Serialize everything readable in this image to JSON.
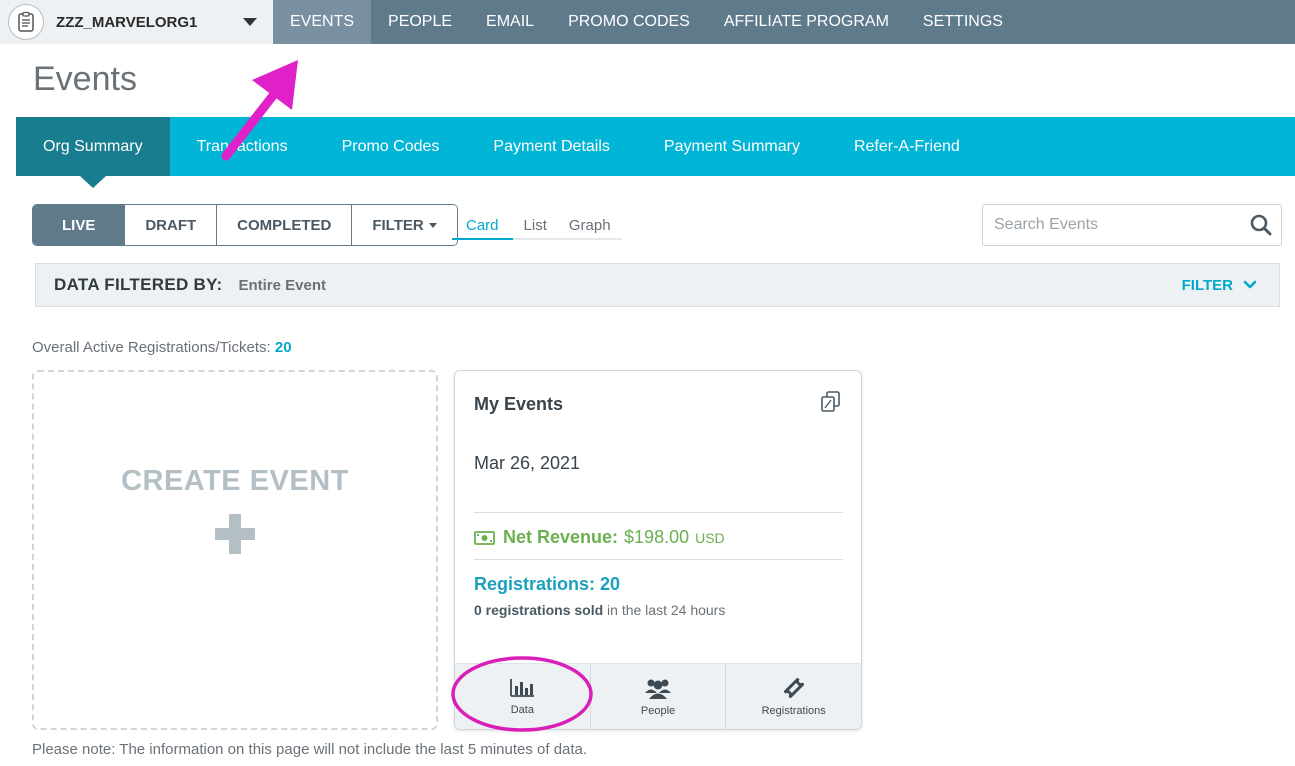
{
  "topnav": {
    "org_name": "ZZZ_MARVELORG1",
    "items": [
      {
        "label": "EVENTS",
        "active": true
      },
      {
        "label": "PEOPLE"
      },
      {
        "label": "EMAIL"
      },
      {
        "label": "PROMO CODES"
      },
      {
        "label": "AFFILIATE PROGRAM"
      },
      {
        "label": "SETTINGS"
      }
    ]
  },
  "page": {
    "title": "Events"
  },
  "tabs": [
    {
      "label": "Org Summary",
      "active": true
    },
    {
      "label": "Transactions"
    },
    {
      "label": "Promo Codes"
    },
    {
      "label": "Payment Details"
    },
    {
      "label": "Payment Summary"
    },
    {
      "label": "Refer-A-Friend"
    }
  ],
  "status_filter": {
    "items": [
      "LIVE",
      "DRAFT",
      "COMPLETED"
    ],
    "filter_label": "FILTER",
    "active": "LIVE"
  },
  "views": {
    "items": [
      "Card",
      "List",
      "Graph"
    ],
    "active": "Card"
  },
  "search": {
    "placeholder": "Search Events"
  },
  "filter_bar": {
    "label": "DATA FILTERED BY:",
    "value": "Entire Event",
    "filter_label": "FILTER"
  },
  "overall": {
    "label": "Overall Active Registrations/Tickets:",
    "count": "20"
  },
  "create_event": {
    "label": "CREATE EVENT"
  },
  "event_card": {
    "title": "My Events",
    "date": "Mar 26, 2021",
    "revenue_label": "Net Revenue:",
    "revenue_amount": "$198.00",
    "revenue_currency": "USD",
    "registrations_label": "Registrations: 20",
    "sold_bold": "0 registrations sold",
    "sold_rest": "in the last 24 hours",
    "actions": [
      "Data",
      "People",
      "Registrations"
    ]
  },
  "note": "Please note: The information on this page will not include the last 5 minutes of data.",
  "colors": {
    "topnav": "#5f7a8a",
    "tab_bar": "#00b5d6",
    "tab_active": "#177d8f",
    "revenue_green": "#6ab150",
    "accent_teal": "#00a9c9",
    "annotation_magenta": "#e020c8"
  }
}
